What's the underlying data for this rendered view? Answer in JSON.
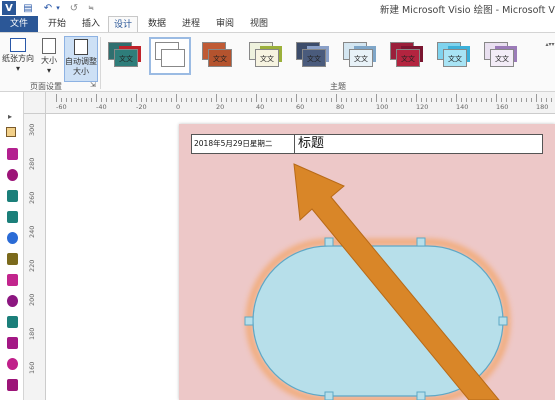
{
  "window": {
    "title": "新建 Microsoft Visio 绘图 - Microsoft Visio",
    "app_badge": "V"
  },
  "quick_access": {
    "save_glyph": "▤",
    "undo_glyph": "↶",
    "dropdown_glyph": "▾",
    "redo_glyph": "↺",
    "customize_glyph": "≒"
  },
  "tabs": [
    "文件",
    "开始",
    "插入",
    "设计",
    "数据",
    "进程",
    "审阅",
    "视图"
  ],
  "active_tab": "设计",
  "ribbon": {
    "page_setup": {
      "orientation_label_1": "纸张方向",
      "size_label_1": "大小",
      "autosize_label_1": "自动调整",
      "autosize_label_2": "大小",
      "dropdown_glyph": "▾",
      "group_label": "页面设置",
      "launcher_glyph": "⇲"
    },
    "themes": {
      "group_label": "主题",
      "items": [
        {
          "text": "文文",
          "color_a": "#2f6f6f",
          "color_b": "#2e7d7a",
          "accent": "#c0222a"
        },
        {
          "text": "",
          "color_a": "#ffffff",
          "color_b": "#ffffff",
          "accent": ""
        },
        {
          "text": "文文",
          "color_a": "#c05a34",
          "color_b": "#b4532e",
          "accent": ""
        },
        {
          "text": "文文",
          "color_a": "#eef2dd",
          "color_b": "#f7f4e1",
          "accent": "#9bb03a"
        },
        {
          "text": "文文",
          "color_a": "#3c4c6a",
          "color_b": "#4a5b7c",
          "accent": "#8aa0c8"
        },
        {
          "text": "文文",
          "color_a": "#d4e6f1",
          "color_b": "#e8f2f8",
          "accent": "#7fa6c8"
        },
        {
          "text": "文文",
          "color_a": "#9a1f3a",
          "color_b": "#b3243f",
          "accent": "#7a1530"
        },
        {
          "text": "文文",
          "color_a": "#7fd3ee",
          "color_b": "#a8e4f5",
          "accent": "#3cb0d9"
        },
        {
          "text": "文文",
          "color_a": "#e9e0f0",
          "color_b": "#f3ecf7",
          "accent": "#9b7bb8"
        }
      ],
      "more_glyph": "▴▾▾"
    }
  },
  "shapes_pane": {
    "collapse_glyph": "▸",
    "stencil_colors": [
      "#b3208f",
      "#9c1478",
      "#1b7f7a",
      "#1b7f7a",
      "#2a6bd6",
      "#7b6a1c",
      "#c2258d",
      "#8c1680",
      "#1b7f7a",
      "#a31784",
      "#c01f8a",
      "#9c1478"
    ]
  },
  "ruler": {
    "h_labels": [
      "-60",
      "-40",
      "-20",
      "0",
      "20",
      "40",
      "60",
      "80",
      "100",
      "120",
      "140",
      "160",
      "180"
    ],
    "v_labels": [
      "300",
      "280",
      "260",
      "240",
      "220",
      "200",
      "180",
      "160"
    ]
  },
  "document": {
    "date_text": "2018年5月29日星期二",
    "title_text": "标题",
    "page_color": "#edc8c8",
    "ellipse_fill": "#b7dfea",
    "ellipse_stroke": "#5ea8c6",
    "glow_color": "#f3a15d",
    "arrow_color": "#d98628",
    "arrow_stroke": "#b86a18"
  },
  "colors": {
    "file_tab": "#2b5797",
    "active_tab_text": "#2b5797"
  }
}
